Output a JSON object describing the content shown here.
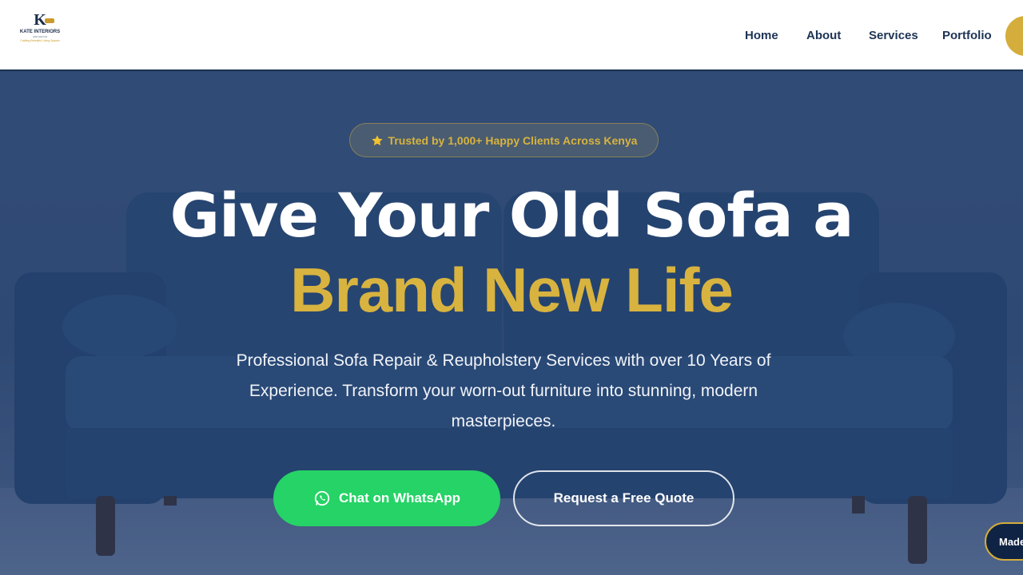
{
  "brand": {
    "mark": "K",
    "name": "KATE INTERIORS",
    "tagline": "AND DECOR",
    "slogan": "Crafting Beautiful Living Spaces"
  },
  "nav": {
    "items": [
      {
        "label": "Home"
      },
      {
        "label": "About"
      },
      {
        "label": "Services"
      },
      {
        "label": "Portfolio"
      }
    ]
  },
  "hero": {
    "badge": "Trusted by 1,000+ Happy Clients Across Kenya",
    "headline": "Give Your Old Sofa a",
    "headline_accent": "Brand New Life",
    "subtitle": "Professional Sofa Repair & Reupholstery Services with over 10 Years of Experience. Transform your worn-out furniture into stunning, modern masterpieces.",
    "cta_whatsapp": "Chat on WhatsApp",
    "cta_quote": "Request a Free Quote"
  },
  "floating_badge": "Made",
  "colors": {
    "navy": "#1d3354",
    "gold": "#d8b33f",
    "whatsapp_green": "#25d366",
    "hero_blue": "#3a5782"
  },
  "icons": {
    "badge": "star-icon",
    "whatsapp": "whatsapp-icon"
  }
}
